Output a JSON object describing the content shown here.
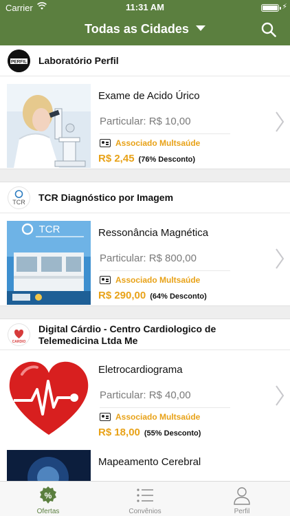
{
  "status_bar": {
    "carrier": "Carrier",
    "time": "11:31 AM"
  },
  "nav": {
    "city_label": "Todas as Cidades"
  },
  "labs": [
    {
      "name": "Laboratório Perfil",
      "logo_text": "PERFIL",
      "offer": {
        "title": "Exame de Acido Úrico",
        "particular": "Particular: R$ 10,00",
        "assoc_label": "Associado Multsaúde",
        "price": "R$ 2,45",
        "discount": "(76% Desconto)"
      }
    },
    {
      "name": "TCR Diagnóstico por Imagem",
      "logo_text": "TCR",
      "offer": {
        "title": "Ressonância Magnética",
        "particular": "Particular: R$ 800,00",
        "assoc_label": "Associado Multsaúde",
        "price": "R$ 290,00",
        "discount": "(64% Desconto)",
        "image_text": "TCR"
      }
    },
    {
      "name": "Digital Cárdio - Centro Cardiologico de Telemedicina Ltda Me",
      "logo_text": "CARDIO",
      "offer": {
        "title": "Eletrocardiograma",
        "particular": "Particular: R$ 40,00",
        "assoc_label": "Associado Multsaúde",
        "price": "R$ 18,00",
        "discount": "(55% Desconto)"
      }
    },
    {
      "offer": {
        "title": "Mapeamento Cerebral"
      }
    }
  ],
  "tabs": [
    {
      "label": "Ofertas",
      "icon": "percent-badge-icon",
      "active": true
    },
    {
      "label": "Convênios",
      "icon": "list-icon",
      "active": false
    },
    {
      "label": "Perfil",
      "icon": "person-icon",
      "active": false
    }
  ],
  "colors": {
    "brand_green": "#5b7f3f",
    "accent_orange": "#e8a218"
  }
}
